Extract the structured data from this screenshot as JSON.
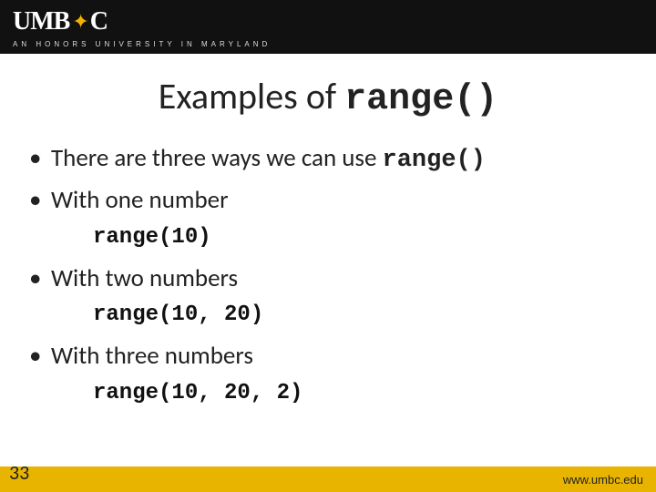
{
  "header": {
    "logo_left": "UMB",
    "logo_right": "C",
    "tagline": "AN HONORS UNIVERSITY IN MARYLAND"
  },
  "title": {
    "prefix": "Examples of ",
    "code": "range()"
  },
  "bullets": {
    "intro_prefix": "There are three ways we can use ",
    "intro_code": "range()",
    "one": "With one number",
    "one_code": "range(10)",
    "two": "With two numbers",
    "two_code": "range(10, 20)",
    "three": "With three numbers",
    "three_code": "range(10, 20, 2)"
  },
  "footer": {
    "page_num": "33",
    "url": "www.umbc.edu"
  }
}
